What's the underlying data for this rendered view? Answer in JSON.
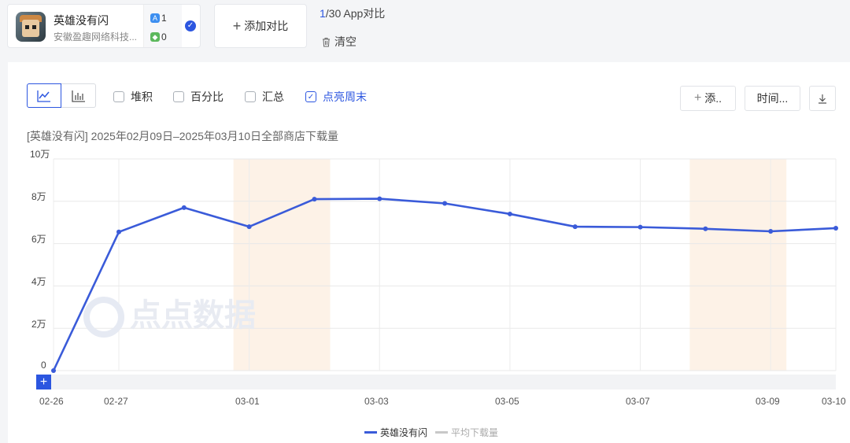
{
  "app": {
    "name": "英雄没有闪",
    "developer": "安徽盈趣网络科技...",
    "ios_count": "1",
    "android_count": "0"
  },
  "compare": {
    "add_label": "添加对比",
    "count_current": "1",
    "count_rest": "/30 App对比",
    "clear_label": "清空"
  },
  "toolbar": {
    "options": [
      {
        "label": "堆积",
        "checked": false
      },
      {
        "label": "百分比",
        "checked": false
      },
      {
        "label": "汇总",
        "checked": false
      },
      {
        "label": "点亮周末",
        "checked": true
      }
    ],
    "add_label": "添..",
    "time_label": "时间..."
  },
  "chart_title": "[英雄没有闪] 2025年02月09日–2025年03月10日全部商店下载量",
  "watermark": "点点数据",
  "chart_data": {
    "type": "line",
    "x_ticks": [
      "02-26",
      "02-27",
      "03-01",
      "03-03",
      "03-05",
      "03-07",
      "03-09",
      "03-10"
    ],
    "y_ticks": [
      "0",
      "2万",
      "4万",
      "6万",
      "8万",
      "10万"
    ],
    "ylim": [
      0,
      100000
    ],
    "grid": true,
    "weekend_bands": [
      [
        "03-01",
        "03-02"
      ],
      [
        "03-08",
        "03-09"
      ]
    ],
    "series": [
      {
        "name": "英雄没有闪",
        "color": "#3a5bd9",
        "points": [
          [
            "02-26",
            0
          ],
          [
            "02-27",
            65500
          ],
          [
            "02-28",
            77000
          ],
          [
            "03-01",
            68000
          ],
          [
            "03-02",
            81000
          ],
          [
            "03-03",
            81200
          ],
          [
            "03-04",
            79000
          ],
          [
            "03-05",
            74000
          ],
          [
            "03-06",
            68000
          ],
          [
            "03-07",
            67800
          ],
          [
            "03-08",
            67000
          ],
          [
            "03-09",
            65800
          ],
          [
            "03-10",
            67300
          ]
        ]
      }
    ],
    "legend": [
      {
        "name": "英雄没有闪",
        "color": "#3a5bd9"
      },
      {
        "name": "平均下载量",
        "color": "#c8c8c8"
      }
    ]
  }
}
